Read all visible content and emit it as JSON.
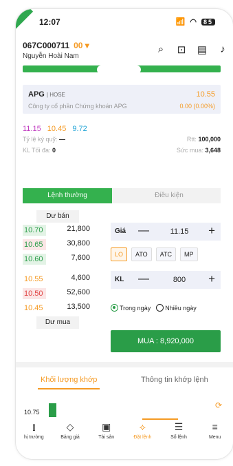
{
  "status": {
    "time": "12:07",
    "signal": "📶",
    "battery": "85"
  },
  "account": {
    "id": "067C000711",
    "sub": "00 ▾",
    "name": "Nguyễn Hoài Nam"
  },
  "icons": {
    "search": "⌕",
    "lock": "🔒",
    "wallet": "▤",
    "bell": "🔔"
  },
  "stock": {
    "symbol": "APG",
    "exchange": "| HOSE",
    "company": "Công ty cổ phần Chứng khoán APG",
    "price": "10.55",
    "change": "0.00 (0.00%)"
  },
  "ref_prices": {
    "ceiling": "11.15",
    "ref": "10.45",
    "floor": "9.72"
  },
  "info": {
    "ky_quy_label": "Tỷ lệ ký quỹ:",
    "ky_quy_value": "—",
    "rtt_label": "Rtt:",
    "rtt_value": "100,000",
    "kl_label": "KL Tối đa:",
    "kl_value": "0",
    "suc_mua_label": "Sức mua:",
    "suc_mua_value": "3,648"
  },
  "order_tabs": {
    "normal": "Lệnh thường",
    "conditional": "Điều kiện"
  },
  "orderbook": {
    "sell_header": "Dư bán",
    "buy_footer": "Dư mua",
    "asks": [
      {
        "price": "10.70",
        "vol": "21,800"
      },
      {
        "price": "10.65",
        "vol": "30,800"
      },
      {
        "price": "10.60",
        "vol": "7,600"
      }
    ],
    "bids": [
      {
        "price": "10.55",
        "vol": "4,600"
      },
      {
        "price": "10.50",
        "vol": "52,600"
      },
      {
        "price": "10.45",
        "vol": "13,500"
      }
    ]
  },
  "form": {
    "price_label": "Giá",
    "price_value": "11.15",
    "qty_label": "KL",
    "qty_value": "800",
    "minus": "—",
    "plus": "+",
    "types": [
      "LO",
      "ATO",
      "ATC",
      "MP"
    ],
    "valid_today": "Trong ngày",
    "valid_multi": "Nhiều ngày",
    "buy_label": "MUA : 8,920,000"
  },
  "sub_tabs": {
    "vol": "Khối lượng khớp",
    "info": "Thông tin khớp lệnh"
  },
  "vol_chart": {
    "price": "10.75"
  },
  "nav": [
    {
      "label": "hị trường",
      "icon": "⫾"
    },
    {
      "label": "Bảng giá",
      "icon": "◇"
    },
    {
      "label": "Tài sản",
      "icon": "▣"
    },
    {
      "label": "Đặt lệnh",
      "icon": "⟡"
    },
    {
      "label": "Sổ lệnh",
      "icon": "☰"
    },
    {
      "label": "Menu",
      "icon": "≡"
    }
  ]
}
